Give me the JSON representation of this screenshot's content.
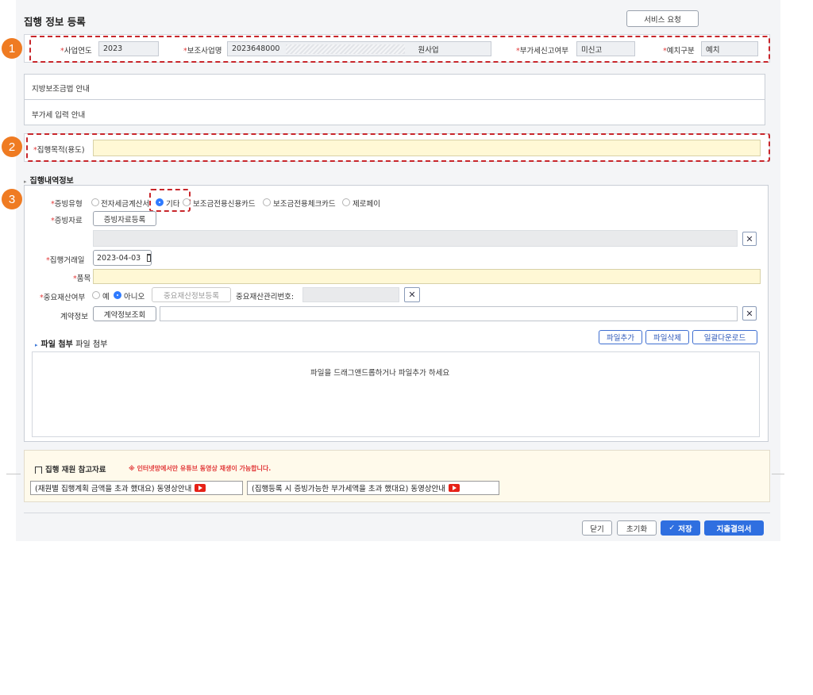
{
  "page": {
    "title": "집행 정보 등록",
    "service_request": "서비스 요청"
  },
  "badges": [
    "1",
    "2",
    "3"
  ],
  "row1": {
    "year_label": "사업연도",
    "year_value": "2023",
    "project_label": "보조사업명",
    "project_value": "2023648000",
    "project_suffix": "원사업",
    "vat_label": "부가세신고여부",
    "vat_value": "미신고",
    "deposit_label": "예치구분",
    "deposit_value": "예치"
  },
  "guides": {
    "law": "지방보조금법 안내",
    "vat": "부가세 입력 안내"
  },
  "purpose": {
    "label": "집행목적(용도)",
    "value": ""
  },
  "detail": {
    "section_title": "집행내역정보",
    "evidence_type_label": "증빙유형",
    "evidence_options": [
      {
        "label": "전자세금계산서",
        "selected": false
      },
      {
        "label": "기타",
        "selected": true
      },
      {
        "label": "보조금전용신용카드",
        "selected": false
      },
      {
        "label": "보조금전용체크카드",
        "selected": false
      },
      {
        "label": "제로페이",
        "selected": false
      }
    ],
    "evidence_doc_label": "증빙자료",
    "evidence_doc_button": "증빙자료등록",
    "date_label": "집행거래일",
    "date_value": "2023-04-03",
    "item_label": "품목",
    "major_label": "중요재산여부",
    "major_yes": "예",
    "major_no": "아니오",
    "major_selected": "아니오",
    "major_button": "중요재산정보등록",
    "major_no_label": "중요재산관리번호:",
    "contract_label": "계약정보",
    "contract_button": "계약정보조회"
  },
  "files": {
    "title": "파일 첨부",
    "subtitle": "파일 첨부",
    "add": "파일추가",
    "delete": "파일삭제",
    "download": "일괄다운로드",
    "drop_text": "파일을 드래그앤드롭하거나  파일추가 하세요"
  },
  "reference": {
    "title": "집행 재원 참고자료",
    "notice": "※ 인터넷망에서만 유튜브 동영상 재생이 가능합니다.",
    "video1": "(재원별 집행계획 금액을 초과 했대요) 동영상안내",
    "video2": "(집행등록 시 증빙가능한 부가세액을 초과 했대요) 동영상안내"
  },
  "footer": {
    "close": "닫기",
    "reset": "초기화",
    "save": "저장",
    "save_check": "✓",
    "expense": "지출결의서"
  },
  "colors": {
    "required": "#e23b3b",
    "primary": "#2f6fe0",
    "badge": "#ef7b22",
    "highlight": "#c8262b",
    "yellow": "#fff8d5"
  }
}
